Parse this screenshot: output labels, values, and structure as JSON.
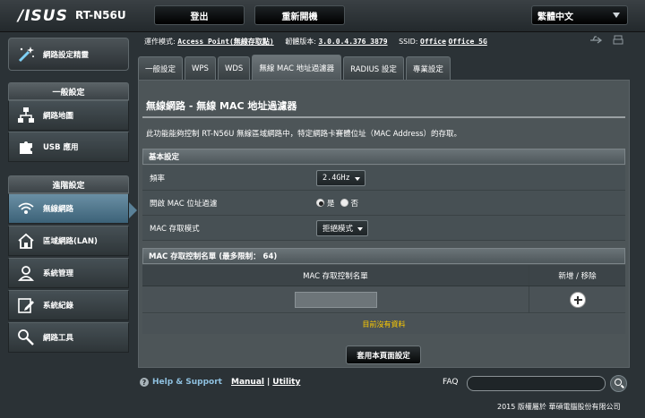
{
  "header": {
    "brand": "/ISUS",
    "model": "RT-N56U",
    "logout_label": "登出",
    "reboot_label": "重新開機",
    "language_label": "繁體中文"
  },
  "sidebar": {
    "quick_label": "網路設定精靈",
    "general_header": "一般設定",
    "general_items": [
      {
        "label": "網路地圖",
        "icon": "network-map-icon"
      },
      {
        "label": "USB 應用",
        "icon": "usb-puzzle-icon"
      }
    ],
    "advanced_header": "進階設定",
    "advanced_items": [
      {
        "label": "無線網路",
        "icon": "wifi-icon"
      },
      {
        "label": "區域網路(LAN)",
        "icon": "home-icon"
      },
      {
        "label": "系統管理",
        "icon": "admin-user-icon"
      },
      {
        "label": "系統紀錄",
        "icon": "system-log-icon"
      },
      {
        "label": "網路工具",
        "icon": "network-tools-icon"
      }
    ],
    "active_item": "無線網路"
  },
  "info": {
    "mode_label": "運作模式:",
    "mode_value": "Access Point(無線存取點)",
    "firmware_label": "韌體版本:",
    "firmware_value": "3.0.0.4.376_3879",
    "ssid_label": "SSID:",
    "ssid_1": "Office",
    "ssid_2": "Office_5G"
  },
  "tabs": [
    {
      "label": "一般設定",
      "active": false
    },
    {
      "label": "WPS",
      "active": false
    },
    {
      "label": "WDS",
      "active": false
    },
    {
      "label": "無線 MAC 地址過濾器",
      "active": true
    },
    {
      "label": "RADIUS 設定",
      "active": false
    },
    {
      "label": "專業設定",
      "active": false
    }
  ],
  "main": {
    "title": "無線網路 - 無線 MAC 地址過濾器",
    "description": "此功能能夠控制 RT-N56U 無線區域網路中，特定網路卡賽體位址（MAC Address）的存取。",
    "basic_header": "基本設定",
    "band_label": "頻率",
    "band_value": "2.4GHz",
    "enable_label": "開啟 MAC 位址過濾",
    "yes_label": "是",
    "no_label": "否",
    "enable_selected": "是",
    "mode_label": "MAC 存取模式",
    "mode_value": "拒絕模式",
    "list_header": "MAC 存取控制名單 (最多限制： 64)",
    "col_mac": "MAC 存取控制名單",
    "col_action": "新增 / 移除",
    "mac_input_value": "",
    "empty_text": "目前沒有資料",
    "apply_label": "套用本頁面設定"
  },
  "footer": {
    "help_label": "Help & Support",
    "manual_label": "Manual",
    "utility_label": "Utility",
    "separator": "|",
    "faq_label": "FAQ",
    "faq_value": "",
    "copyright": "2015 版權屬於 華碩電腦股份有限公司"
  },
  "colors": {
    "accent": "#5a8198",
    "warning_text": "#ffcc00",
    "background": "#2b3236"
  }
}
